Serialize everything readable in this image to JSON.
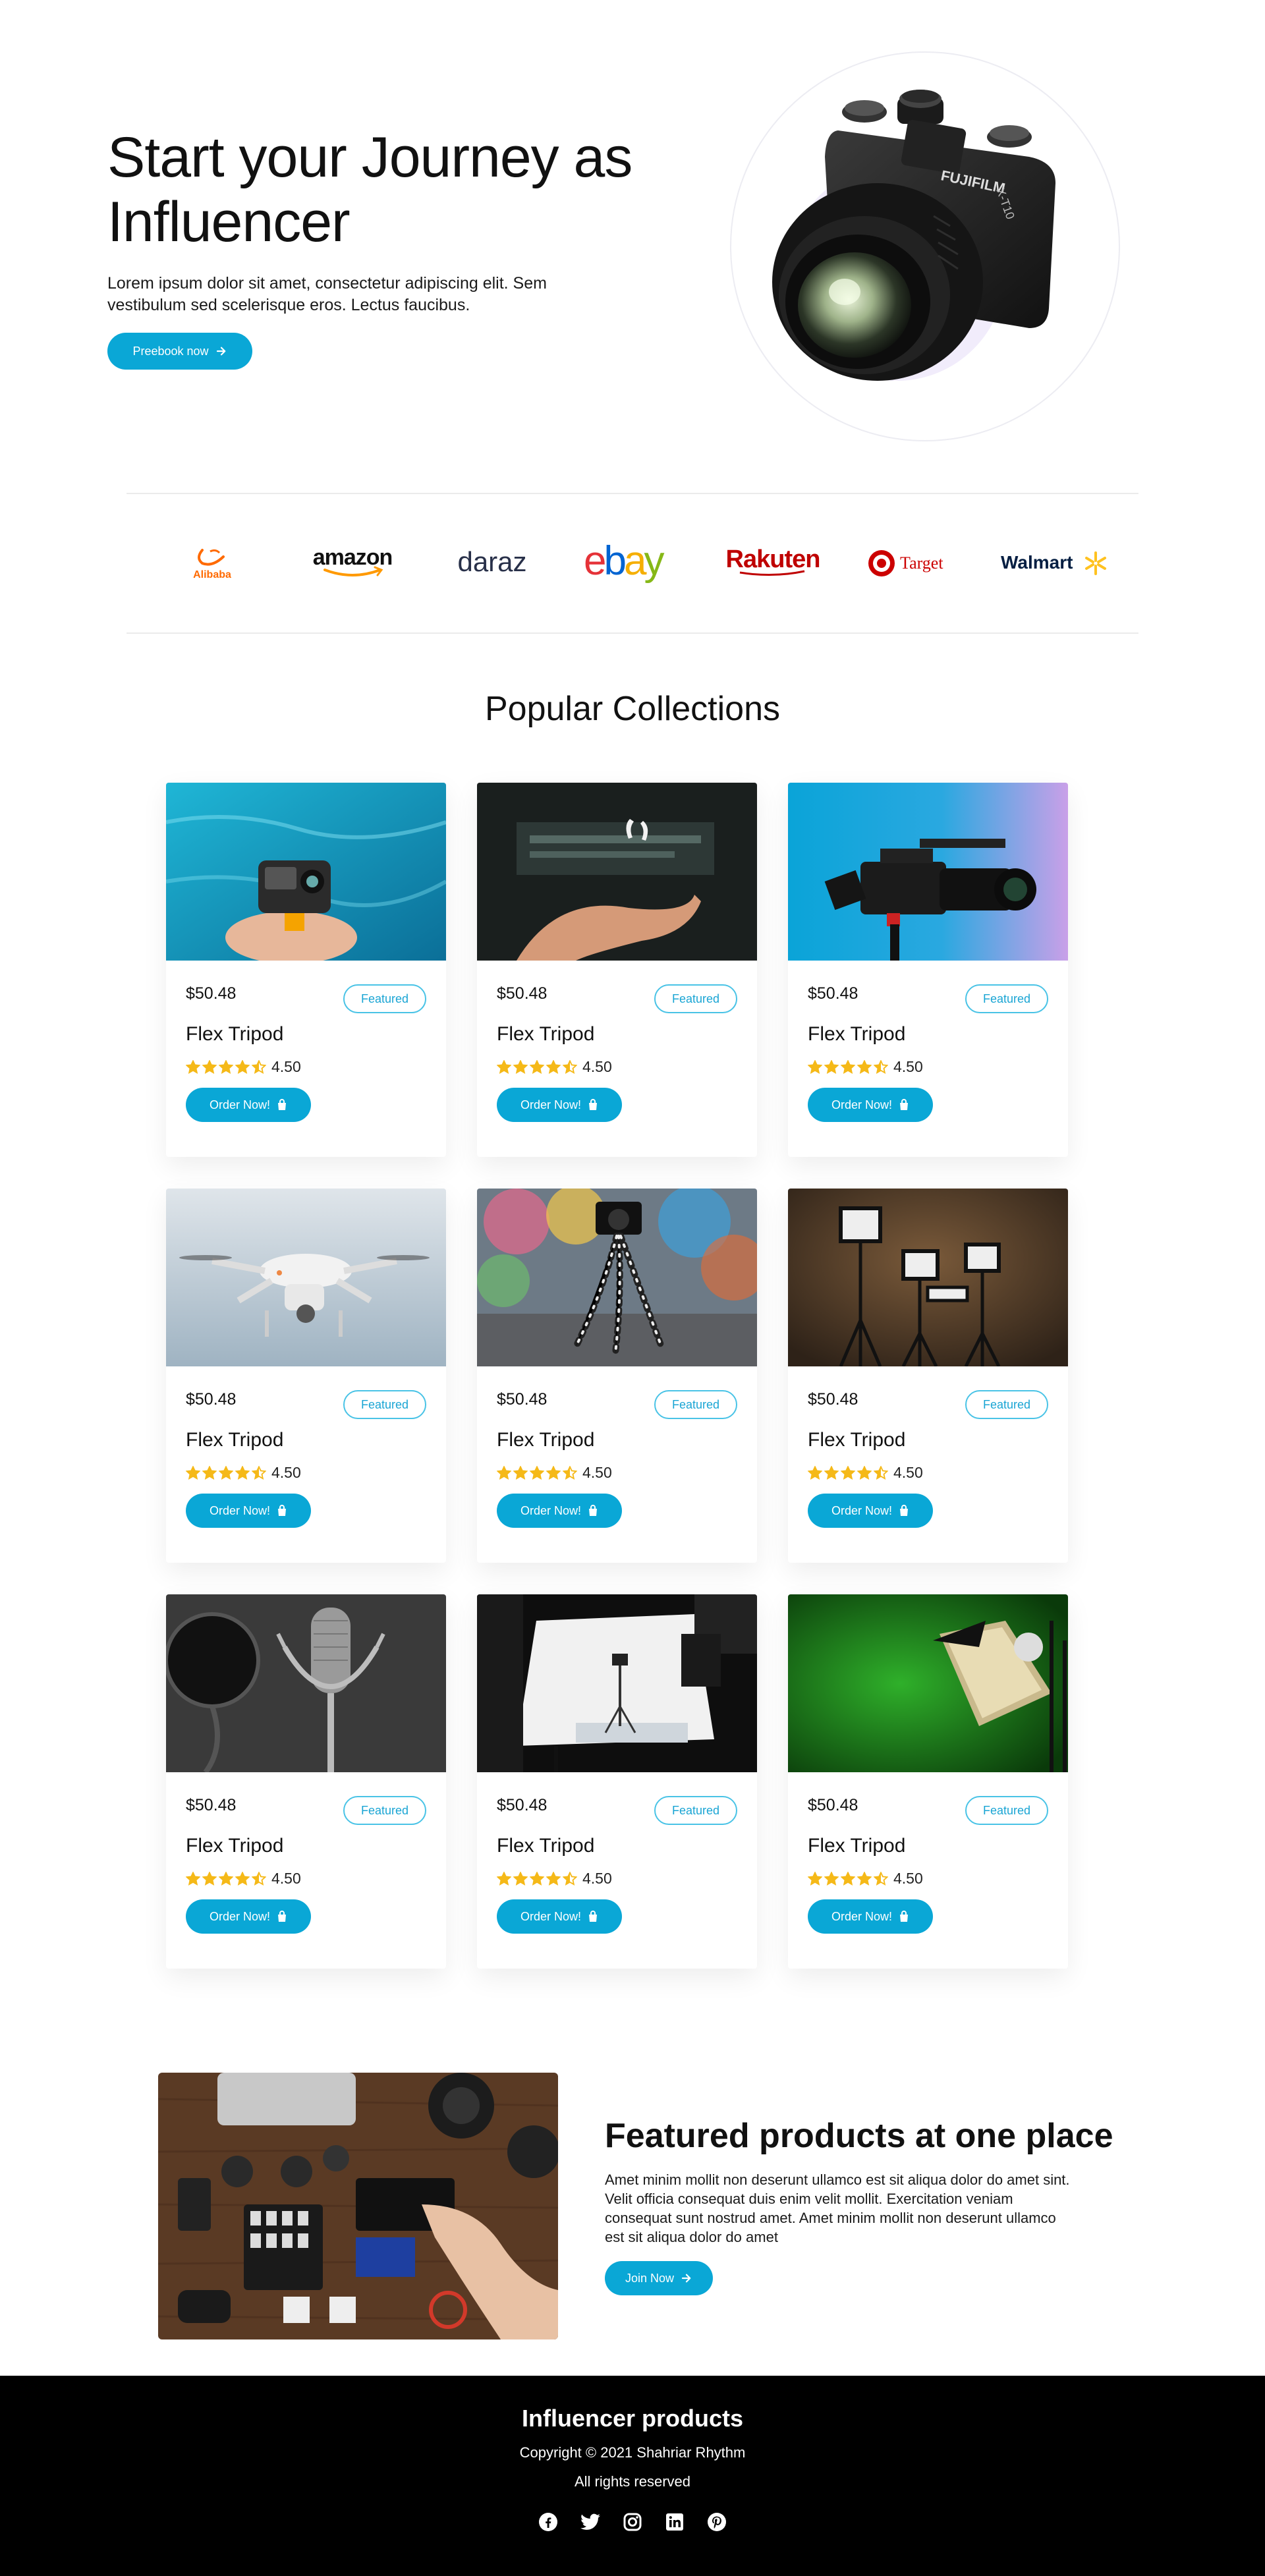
{
  "hero": {
    "title": "Start your Journey as Influencer",
    "text": "Lorem ipsum dolor sit amet, consectetur adipiscing elit. Sem vestibulum sed scelerisque eros. Lectus faucibus.",
    "button_label": "Preebook now",
    "camera_brand": "FUJIFILM",
    "camera_model": "X-T10"
  },
  "brands": {
    "alibaba": "Alibaba",
    "amazon": "amazon",
    "daraz": "daraz",
    "ebay": {
      "e": "e",
      "b": "b",
      "a": "a",
      "y": "y"
    },
    "rakuten": "Rakuten",
    "target": "Target",
    "walmart": "Walmart"
  },
  "collections": {
    "title": "Popular Collections",
    "products": [
      {
        "price": "$50.48",
        "badge": "Featured",
        "name": "Flex Tripod",
        "rating": "4.50",
        "button": "Order Now!",
        "image": "gopro-water"
      },
      {
        "price": "$50.48",
        "badge": "Featured",
        "name": "Flex Tripod",
        "rating": "4.50",
        "button": "Order Now!",
        "image": "airpods-hand"
      },
      {
        "price": "$50.48",
        "badge": "Featured",
        "name": "Flex Tripod",
        "rating": "4.50",
        "button": "Order Now!",
        "image": "cinema-camera"
      },
      {
        "price": "$50.48",
        "badge": "Featured",
        "name": "Flex Tripod",
        "rating": "4.50",
        "button": "Order Now!",
        "image": "drone-sky"
      },
      {
        "price": "$50.48",
        "badge": "Featured",
        "name": "Flex Tripod",
        "rating": "4.50",
        "button": "Order Now!",
        "image": "flex-tripod"
      },
      {
        "price": "$50.48",
        "badge": "Featured",
        "name": "Flex Tripod",
        "rating": "4.50",
        "button": "Order Now!",
        "image": "led-lights"
      },
      {
        "price": "$50.48",
        "badge": "Featured",
        "name": "Flex Tripod",
        "rating": "4.50",
        "button": "Order Now!",
        "image": "studio-mic"
      },
      {
        "price": "$50.48",
        "badge": "Featured",
        "name": "Flex Tripod",
        "rating": "4.50",
        "button": "Order Now!",
        "image": "photo-studio"
      },
      {
        "price": "$50.48",
        "badge": "Featured",
        "name": "Flex Tripod",
        "rating": "4.50",
        "button": "Order Now!",
        "image": "green-screen-softbox"
      }
    ],
    "rating_stars": 4.5
  },
  "featured": {
    "title": "Featured products at one place",
    "text": "Amet minim mollit non deserunt ullamco est sit aliqua dolor do amet sint. Velit officia consequat duis enim velit mollit. Exercitation veniam consequat sunt nostrud amet. Amet minim mollit non deserunt ullamco est sit aliqua dolor do amet",
    "button_label": "Join Now"
  },
  "footer": {
    "title": "Influencer products",
    "copyright": "Copyright © 2021 Shahriar Rhythm",
    "rights": "All rights reserved",
    "socials": [
      "facebook-icon",
      "twitter-icon",
      "instagram-icon",
      "linkedin-icon",
      "pinterest-icon"
    ]
  },
  "colors": {
    "accent": "#0aa7d6",
    "star": "#f5b918",
    "footer_bg": "#000000"
  }
}
